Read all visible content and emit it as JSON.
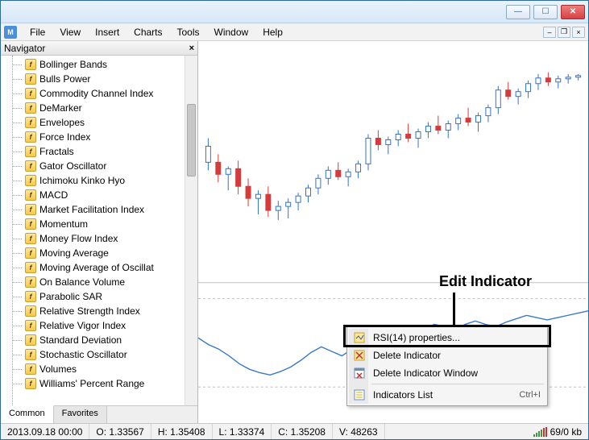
{
  "menubar": {
    "items": [
      "File",
      "View",
      "Insert",
      "Charts",
      "Tools",
      "Window",
      "Help"
    ]
  },
  "navigator": {
    "title": "Navigator",
    "tabs": {
      "common": "Common",
      "favorites": "Favorites"
    },
    "items": [
      "Bollinger Bands",
      "Bulls Power",
      "Commodity Channel Index",
      "DeMarker",
      "Envelopes",
      "Force Index",
      "Fractals",
      "Gator Oscillator",
      "Ichimoku Kinko Hyo",
      "MACD",
      "Market Facilitation Index",
      "Momentum",
      "Money Flow Index",
      "Moving Average",
      "Moving Average of Oscillat",
      "On Balance Volume",
      "Parabolic SAR",
      "Relative Strength Index",
      "Relative Vigor Index",
      "Standard Deviation",
      "Stochastic Oscillator",
      "Volumes",
      "Williams' Percent Range"
    ]
  },
  "context_menu": {
    "properties": "RSI(14) properties...",
    "delete_ind": "Delete Indicator",
    "delete_win": "Delete Indicator Window",
    "list": "Indicators List",
    "list_shortcut": "Ctrl+I"
  },
  "annotation": {
    "label": "Edit Indicator"
  },
  "statusbar": {
    "datetime": "2013.09.18 00:00",
    "open": "O: 1.33567",
    "high": "H: 1.35408",
    "low": "L: 1.33374",
    "close": "C: 1.35208",
    "vol": "V: 48263",
    "net": "69/0 kb"
  },
  "chart_data": {
    "type": "candlestick+line",
    "upper": {
      "type": "candlestick",
      "candles": [
        {
          "o": 130,
          "h": 120,
          "l": 160,
          "c": 150,
          "dir": "up"
        },
        {
          "o": 150,
          "h": 140,
          "l": 175,
          "c": 165,
          "dir": "down"
        },
        {
          "o": 165,
          "h": 155,
          "l": 185,
          "c": 158,
          "dir": "up"
        },
        {
          "o": 158,
          "h": 148,
          "l": 190,
          "c": 180,
          "dir": "down"
        },
        {
          "o": 180,
          "h": 170,
          "l": 205,
          "c": 195,
          "dir": "down"
        },
        {
          "o": 195,
          "h": 185,
          "l": 215,
          "c": 190,
          "dir": "up"
        },
        {
          "o": 190,
          "h": 180,
          "l": 218,
          "c": 210,
          "dir": "down"
        },
        {
          "o": 210,
          "h": 198,
          "l": 222,
          "c": 205,
          "dir": "up"
        },
        {
          "o": 205,
          "h": 195,
          "l": 220,
          "c": 200,
          "dir": "up"
        },
        {
          "o": 200,
          "h": 188,
          "l": 210,
          "c": 192,
          "dir": "up"
        },
        {
          "o": 192,
          "h": 178,
          "l": 200,
          "c": 182,
          "dir": "up"
        },
        {
          "o": 182,
          "h": 165,
          "l": 190,
          "c": 170,
          "dir": "up"
        },
        {
          "o": 170,
          "h": 155,
          "l": 178,
          "c": 160,
          "dir": "up"
        },
        {
          "o": 160,
          "h": 150,
          "l": 172,
          "c": 168,
          "dir": "down"
        },
        {
          "o": 168,
          "h": 158,
          "l": 180,
          "c": 162,
          "dir": "up"
        },
        {
          "o": 162,
          "h": 148,
          "l": 170,
          "c": 152,
          "dir": "up"
        },
        {
          "o": 152,
          "h": 115,
          "l": 160,
          "c": 120,
          "dir": "up"
        },
        {
          "o": 120,
          "h": 110,
          "l": 135,
          "c": 128,
          "dir": "down"
        },
        {
          "o": 128,
          "h": 118,
          "l": 140,
          "c": 122,
          "dir": "up"
        },
        {
          "o": 122,
          "h": 110,
          "l": 130,
          "c": 115,
          "dir": "up"
        },
        {
          "o": 115,
          "h": 102,
          "l": 125,
          "c": 120,
          "dir": "down"
        },
        {
          "o": 120,
          "h": 108,
          "l": 132,
          "c": 112,
          "dir": "up"
        },
        {
          "o": 112,
          "h": 100,
          "l": 120,
          "c": 105,
          "dir": "up"
        },
        {
          "o": 105,
          "h": 92,
          "l": 115,
          "c": 110,
          "dir": "down"
        },
        {
          "o": 110,
          "h": 98,
          "l": 120,
          "c": 102,
          "dir": "up"
        },
        {
          "o": 102,
          "h": 90,
          "l": 110,
          "c": 95,
          "dir": "up"
        },
        {
          "o": 95,
          "h": 82,
          "l": 105,
          "c": 100,
          "dir": "down"
        },
        {
          "o": 100,
          "h": 88,
          "l": 112,
          "c": 92,
          "dir": "up"
        },
        {
          "o": 92,
          "h": 78,
          "l": 100,
          "c": 82,
          "dir": "up"
        },
        {
          "o": 82,
          "h": 55,
          "l": 90,
          "c": 60,
          "dir": "up"
        },
        {
          "o": 60,
          "h": 50,
          "l": 72,
          "c": 68,
          "dir": "down"
        },
        {
          "o": 68,
          "h": 58,
          "l": 78,
          "c": 62,
          "dir": "up"
        },
        {
          "o": 62,
          "h": 48,
          "l": 70,
          "c": 52,
          "dir": "up"
        },
        {
          "o": 52,
          "h": 40,
          "l": 60,
          "c": 45,
          "dir": "up"
        },
        {
          "o": 45,
          "h": 38,
          "l": 55,
          "c": 50,
          "dir": "down"
        },
        {
          "o": 50,
          "h": 42,
          "l": 58,
          "c": 46,
          "dir": "up"
        },
        {
          "o": 46,
          "h": 40,
          "l": 52,
          "c": 44,
          "dir": "up"
        },
        {
          "o": 44,
          "h": 40,
          "l": 48,
          "c": 42,
          "dir": "up"
        }
      ]
    },
    "lower": {
      "type": "line",
      "name": "RSI(14)",
      "ylim": [
        0,
        100
      ],
      "levels": [
        30,
        70
      ],
      "values": [
        58,
        52,
        48,
        42,
        35,
        30,
        27,
        25,
        28,
        32,
        38,
        45,
        50,
        46,
        42,
        48,
        55,
        62,
        58,
        52,
        56,
        60,
        66,
        70,
        68,
        65,
        70,
        73,
        70,
        68,
        72,
        75,
        78,
        76,
        74,
        76,
        78,
        80,
        82
      ]
    }
  }
}
